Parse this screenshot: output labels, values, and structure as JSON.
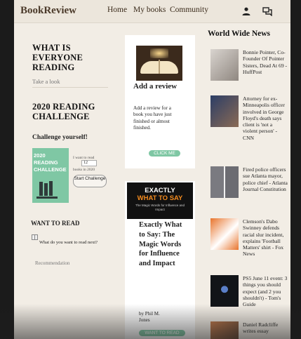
{
  "header": {
    "brand": "BookReview",
    "nav": [
      "Home",
      "My books",
      "Community"
    ],
    "icons": [
      "account-icon",
      "chat-icon"
    ]
  },
  "left": {
    "everyone_title": "WHAT IS EVERYONE READING",
    "take_a_look": "Take a look",
    "challenge_title": "2020 READING CHALLENGE",
    "challenge_yourself": "Challenge yourself!",
    "challenge_img_text": "2020 READING CHALLENGE",
    "want_to_read_small": "I want to read",
    "books_value": "12",
    "books_in_2020": "books in 2020",
    "start_challenge": "Start Challenge",
    "want_to_read_title": "WANT TO READ",
    "want_prompt": "What do you want to read next?",
    "recommendation": "Recommendation"
  },
  "middle": {
    "add_review_title": "Add a review",
    "add_review_text": "Add a review for a book you have just finished or almost finished.",
    "click_me": "CLICK ME",
    "book_cover_top": "EXACTLY",
    "book_cover_mid": "WHAT TO SAY",
    "book_cover_sub": "The Magic Words for Influence and Impact",
    "book_title": "Exactly What to Say: The Magic Words for Influence and Impact",
    "book_author": "by Phil M. Jones",
    "want_to_read_btn": "WANT TO READ"
  },
  "news": {
    "title": "World Wide News",
    "items": [
      "Bonnie Pointer, Co-Founder Of Pointer Sisters, Dead At 69 - HuffPost",
      "Attorney for ex-Minneapolis officer involved in George Floyd's death says client is 'not a violent person' - CNN",
      "Fired police officers sue Atlanta mayor, police chief - Atlanta Journal Constitution",
      "Clemson's Dabo Swinney defends racial slur incident, explains 'Football Matters' shirt - Fox News",
      "PS5 June 11 event: 3 things you should expect (and 2 you shouldn't) - Tom's Guide",
      "Daniel Radcliffe writes essay"
    ],
    "thumb_colors": [
      "#b9b3ad",
      "#3a4f77",
      "#6d6d73",
      "#d86b2a",
      "#111418",
      "#c27a4c"
    ]
  },
  "colors": {
    "accent_green": "#7fc7a4",
    "brand_brown": "#4b3a2a"
  }
}
